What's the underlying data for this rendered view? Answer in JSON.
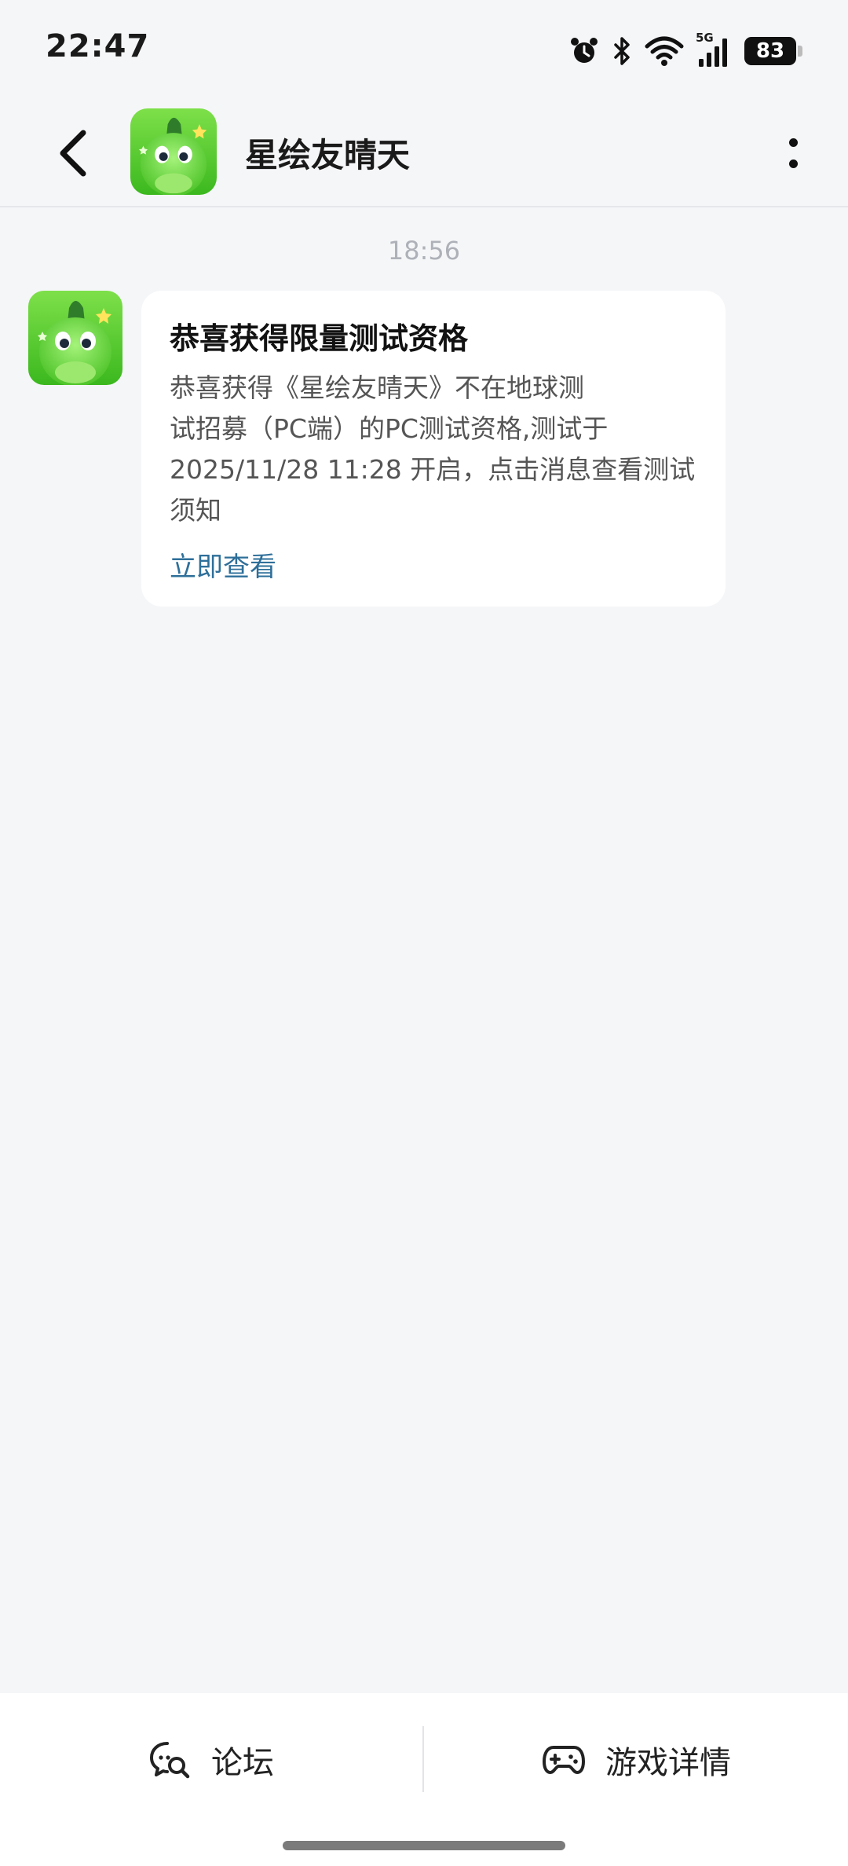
{
  "status_bar": {
    "time": "22:47",
    "network_label": "5G",
    "battery_level": "83",
    "icons": [
      "alarm-icon",
      "bluetooth-icon",
      "wifi-icon",
      "signal-icon",
      "battery-icon"
    ]
  },
  "header": {
    "title": "星绘友晴天",
    "avatar_icon": "green-dinosaur-avatar",
    "back_icon": "chevron-left-icon",
    "more_icon": "more-vertical-icon"
  },
  "messages": [
    {
      "time": "18:56",
      "title": "恭喜获得限量测试资格",
      "body_lines": [
        "恭喜获得《星绘友晴天》不在地球测",
        "试招募（PC端）的PC测试资格,测试于",
        "2025/11/28 11:28 开启，点击消息查看测试",
        "须知"
      ],
      "link": "立即查看"
    }
  ],
  "bottom_bar": {
    "forum_label": "论坛",
    "forum_icon": "chat-search-icon",
    "game_details_label": "游戏详情",
    "game_details_icon": "gamepad-icon"
  },
  "colors": {
    "background": "#f5f6f8",
    "link": "#2e6f9a",
    "avatar_green": "#5fd32a"
  }
}
